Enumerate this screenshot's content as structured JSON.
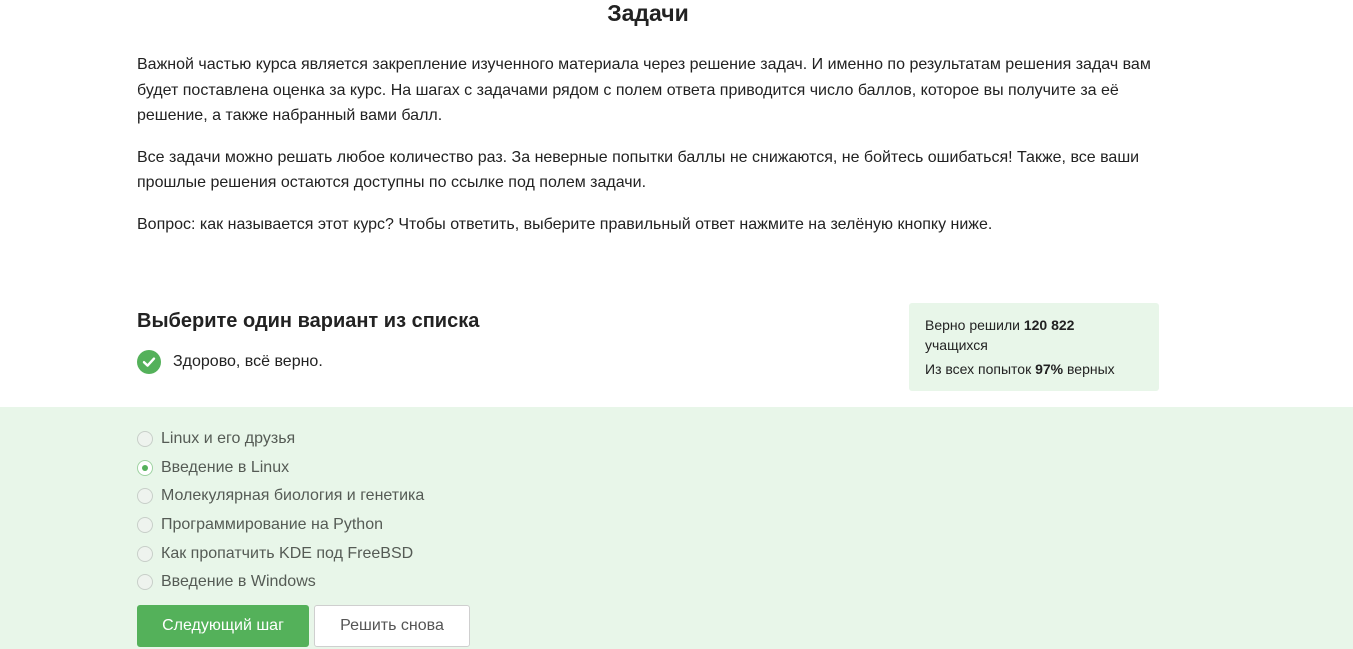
{
  "lesson": {
    "title": "Задачи",
    "paragraphs": [
      "Важной частью курса является закрепление изученного материала через решение задач. И именно по результатам решения задач вам будет поставлена оценка за курс. На шагах с задачами рядом с полем ответа приводится число баллов, которое вы получите за её решение, а также набранный вами балл.",
      "Все задачи можно решать любое количество раз. За неверные попытки баллы не снижаются, не бойтесь ошибаться! Также, все ваши прошлые решения остаются доступны по ссылке под полем задачи.",
      "Вопрос: как называется этот курс? Чтобы ответить, выберите правильный ответ нажмите на зелёную кнопку ниже."
    ]
  },
  "quiz": {
    "heading": "Выберите один вариант из списка",
    "feedback": "Здорово, всё верно.",
    "options": [
      {
        "label": "Linux и его друзья",
        "checked": false
      },
      {
        "label": "Введение в Linux",
        "checked": true
      },
      {
        "label": "Молекулярная биология и генетика",
        "checked": false
      },
      {
        "label": "Программирование на Python",
        "checked": false
      },
      {
        "label": "Как пропатчить KDE под FreeBSD",
        "checked": false
      },
      {
        "label": "Введение в Windows",
        "checked": false
      }
    ]
  },
  "stats": {
    "solved_prefix": "Верно решили",
    "solved_count": "120 822",
    "solved_suffix": "учащихся",
    "attempts_prefix": "Из всех попыток",
    "attempts_percent": "97%",
    "attempts_suffix": "верных"
  },
  "buttons": {
    "next": "Следующий шаг",
    "retry": "Решить снова"
  },
  "colors": {
    "accent_green": "#54b15a",
    "answer_background": "#e8f6e9"
  },
  "icons": {
    "feedback": "check-circle-icon"
  }
}
